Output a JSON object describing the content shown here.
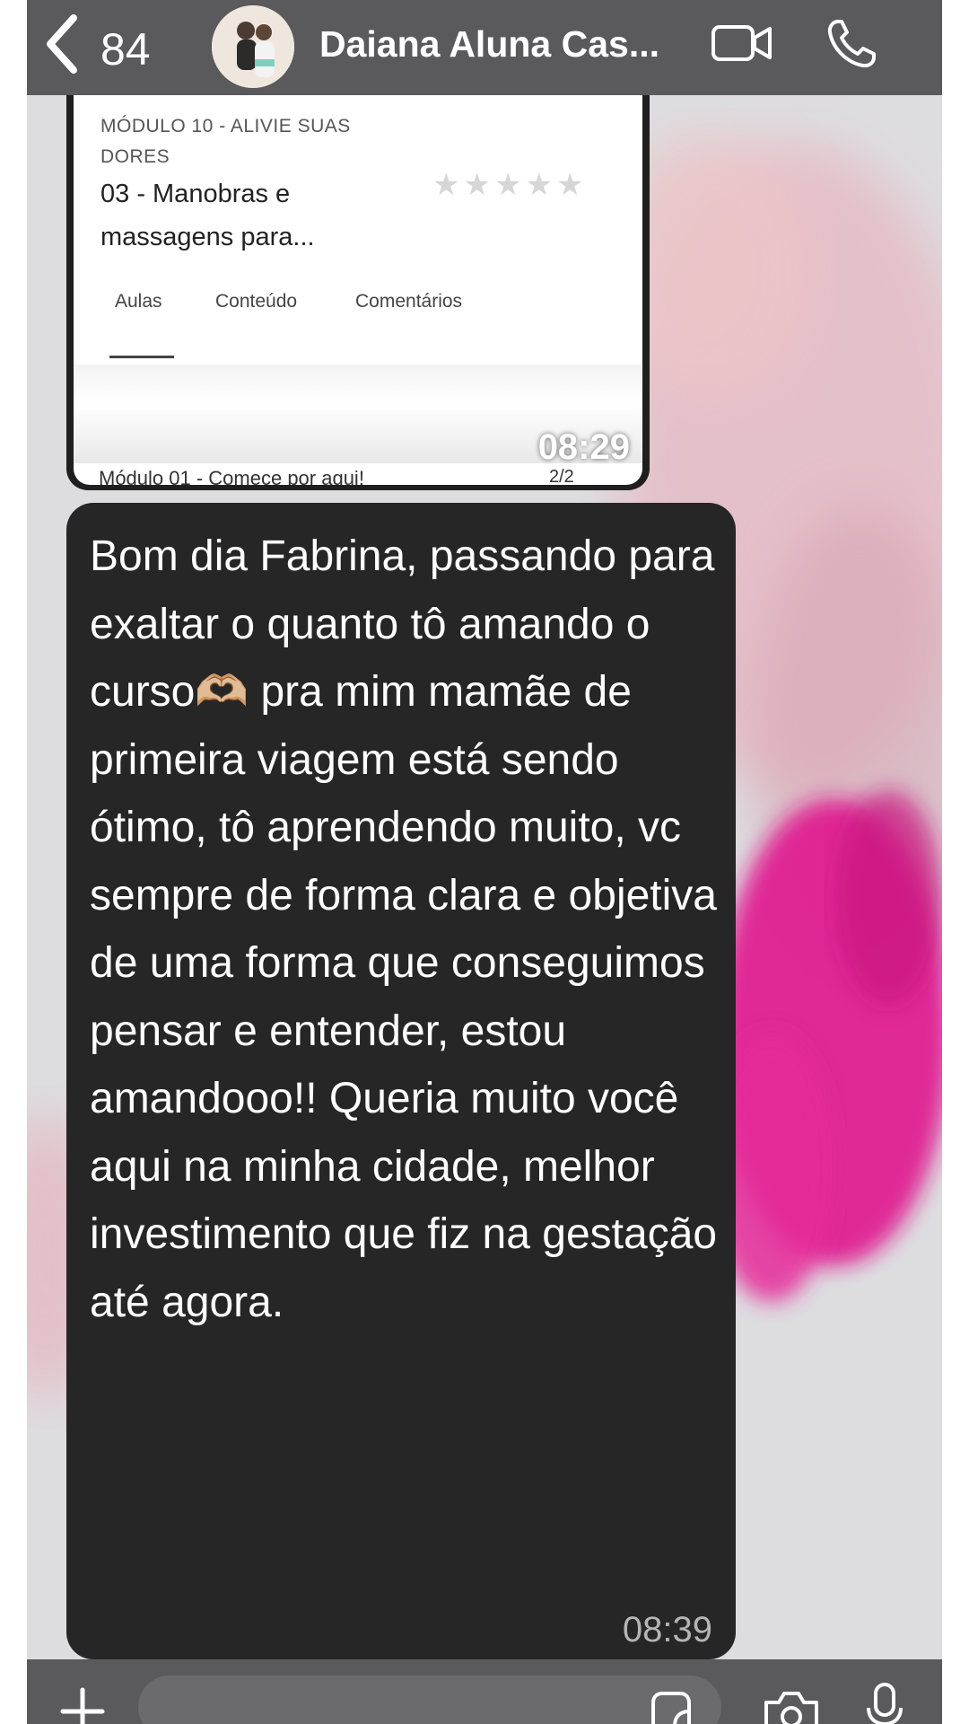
{
  "header": {
    "back_count": "84",
    "contact_name": "Daiana Aluna Cas..."
  },
  "screenshot_message": {
    "module_title": "MÓDULO 10 - ALIVIE SUAS DORES",
    "lesson_title": "03 - Manobras e massagens para...",
    "rating_stars": 0,
    "tabs": [
      "Aulas",
      "Conteúdo",
      "Comentários"
    ],
    "active_tab": "Aulas",
    "module_row": "Módulo 01 - Comece por aqui!",
    "pager": "2/2",
    "time": "08:29"
  },
  "text_message": {
    "body_before_emoji": "Bom dia Fabrina, passando para exaltar o quanto tô amando o curso",
    "emoji": "🫶🏼",
    "body_after_emoji": " pra mim mamãe de primeira viagem está sendo ótimo, tô aprendendo muito, vc sempre de forma clara e objetiva de uma forma que conseguimos pensar e entender, estou amandooo!! Queria muito você aqui na minha cidade, melhor investimento que fiz na gestação até agora.",
    "time": "08:39"
  },
  "colors": {
    "header_bg": "#5a5a5c",
    "bubble_bg": "#262626",
    "wallpaper_pink": "#e0188f"
  },
  "icons": [
    "chevron-left-icon",
    "video-call-icon",
    "phone-icon",
    "plus-icon",
    "sticker-icon",
    "camera-icon",
    "microphone-icon",
    "star-icon",
    "heart-hands-emoji"
  ]
}
